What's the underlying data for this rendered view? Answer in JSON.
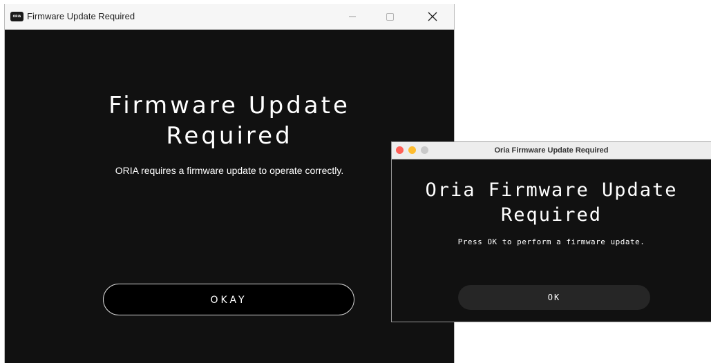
{
  "windows_dialog": {
    "app_icon_text": "ORIA",
    "title": "Firmware Update Required",
    "heading_line1": "Firmware Update",
    "heading_line2": "Required",
    "message": "ORIA requires a firmware update to operate correctly.",
    "button_label": "OKAY"
  },
  "mac_dialog": {
    "title": "Oria Firmware Update Required",
    "heading_line1": "Oria Firmware Update",
    "heading_line2": "Required",
    "message": "Press OK to perform a firmware update.",
    "button_label": "OK"
  },
  "colors": {
    "dialog_background": "#111111",
    "mac_close": "#fe5f57",
    "mac_minimize": "#febc2e",
    "mac_zoom_inactive": "#c9c9c9",
    "mac_button": "#262626"
  }
}
